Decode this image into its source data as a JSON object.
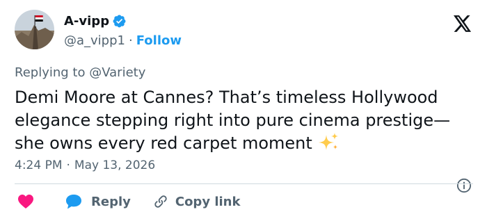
{
  "user": {
    "display_name": "A-vipp",
    "handle": "@a_vipp1",
    "separator": "·",
    "follow_label": "Follow"
  },
  "reply_context": {
    "prefix": "Replying to",
    "mention": "@Variety"
  },
  "tweet": {
    "text": "Demi Moore at Cannes? That’s timeless Hollywood elegance stepping right into pure cinema prestige—she owns every red carpet moment",
    "emoji": "sparkles-icon"
  },
  "meta": {
    "time": "4:24 PM",
    "separator": "·",
    "date": "May 13, 2026"
  },
  "actions": {
    "reply_label": "Reply",
    "copy_label": "Copy link"
  },
  "colors": {
    "accent": "#1d9bf0",
    "like": "#f91880",
    "text": "#0f1419",
    "muted": "#536471",
    "divider": "#cfd9de"
  }
}
